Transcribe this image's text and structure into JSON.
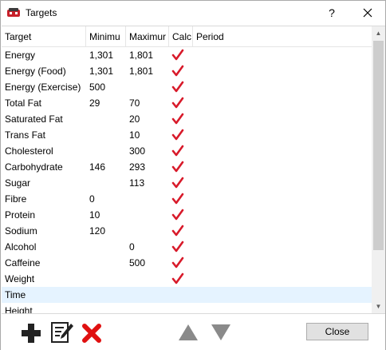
{
  "window": {
    "title": "Targets"
  },
  "titlebar": {
    "help_label": "?"
  },
  "columns": {
    "target": "Target",
    "minimum": "Minimu",
    "maximum": "Maximur",
    "calc": "Calc",
    "period": "Period"
  },
  "rows": [
    {
      "target": "Energy",
      "minimum": "1,301",
      "maximum": "1,801",
      "calc": true,
      "period": ""
    },
    {
      "target": "Energy (Food)",
      "minimum": "1,301",
      "maximum": "1,801",
      "calc": true,
      "period": ""
    },
    {
      "target": "Energy (Exercise)",
      "minimum": "500",
      "maximum": "",
      "calc": true,
      "period": ""
    },
    {
      "target": "Total Fat",
      "minimum": "29",
      "maximum": "70",
      "calc": true,
      "period": ""
    },
    {
      "target": "Saturated Fat",
      "minimum": "",
      "maximum": "20",
      "calc": true,
      "period": ""
    },
    {
      "target": "Trans Fat",
      "minimum": "",
      "maximum": "10",
      "calc": true,
      "period": ""
    },
    {
      "target": "Cholesterol",
      "minimum": "",
      "maximum": "300",
      "calc": true,
      "period": ""
    },
    {
      "target": "Carbohydrate",
      "minimum": "146",
      "maximum": "293",
      "calc": true,
      "period": ""
    },
    {
      "target": "Sugar",
      "minimum": "",
      "maximum": "113",
      "calc": true,
      "period": ""
    },
    {
      "target": "Fibre",
      "minimum": "0",
      "maximum": "",
      "calc": true,
      "period": ""
    },
    {
      "target": "Protein",
      "minimum": "10",
      "maximum": "",
      "calc": true,
      "period": ""
    },
    {
      "target": "Sodium",
      "minimum": "120",
      "maximum": "",
      "calc": true,
      "period": ""
    },
    {
      "target": "Alcohol",
      "minimum": "",
      "maximum": "0",
      "calc": true,
      "period": ""
    },
    {
      "target": "Caffeine",
      "minimum": "",
      "maximum": "500",
      "calc": true,
      "period": ""
    },
    {
      "target": "Weight",
      "minimum": "",
      "maximum": "",
      "calc": true,
      "period": ""
    },
    {
      "target": "Time",
      "minimum": "",
      "maximum": "",
      "calc": false,
      "period": "",
      "selected": true
    },
    {
      "target": "Height",
      "minimum": "",
      "maximum": "",
      "calc": false,
      "period": ""
    }
  ],
  "toolbar": {
    "add_icon": "plus-icon",
    "edit_icon": "edit-icon",
    "delete_icon": "delete-x-icon",
    "move_up_icon": "triangle-up-icon",
    "move_down_icon": "triangle-down-icon",
    "close_label": "Close"
  },
  "colors": {
    "check": "#d81a2a",
    "add_plus": "#222222",
    "delete_x": "#e01010",
    "arrow_gray": "#8a8a8a",
    "selected_row": "#e5f3ff"
  }
}
